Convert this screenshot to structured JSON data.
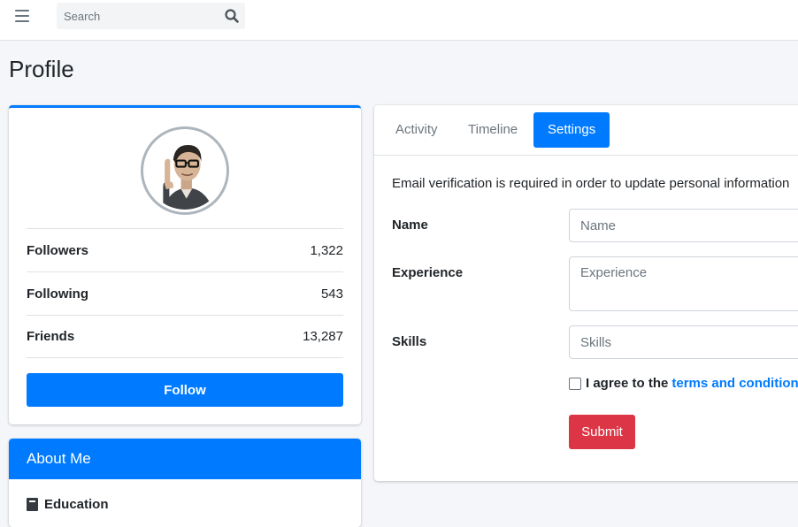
{
  "topbar": {
    "menu_icon": "hamburger-icon",
    "search_placeholder": "Search",
    "search_icon": "search-icon"
  },
  "page": {
    "title": "Profile"
  },
  "profile": {
    "avatar_icon": "user-avatar",
    "stats": [
      {
        "label": "Followers",
        "value": "1,322"
      },
      {
        "label": "Following",
        "value": "543"
      },
      {
        "label": "Friends",
        "value": "13,287"
      }
    ],
    "follow_label": "Follow"
  },
  "about": {
    "title": "About Me",
    "education_icon": "book-icon",
    "education_label": "Education"
  },
  "tabs": [
    {
      "label": "Activity",
      "active": false
    },
    {
      "label": "Timeline",
      "active": false
    },
    {
      "label": "Settings",
      "active": true
    }
  ],
  "settings": {
    "notice": "Email verification is required in order to update personal information",
    "fields": [
      {
        "label": "Name",
        "placeholder": "Name",
        "value": ""
      },
      {
        "label": "Experience",
        "placeholder": "Experience",
        "value": ""
      },
      {
        "label": "Skills",
        "placeholder": "Skills",
        "value": ""
      }
    ],
    "agree_text": "I agree to the",
    "terms_link": "terms and conditions",
    "submit_label": "Submit"
  },
  "colors": {
    "primary": "#007bff",
    "danger": "#dc3545",
    "background": "#f4f6f9"
  }
}
